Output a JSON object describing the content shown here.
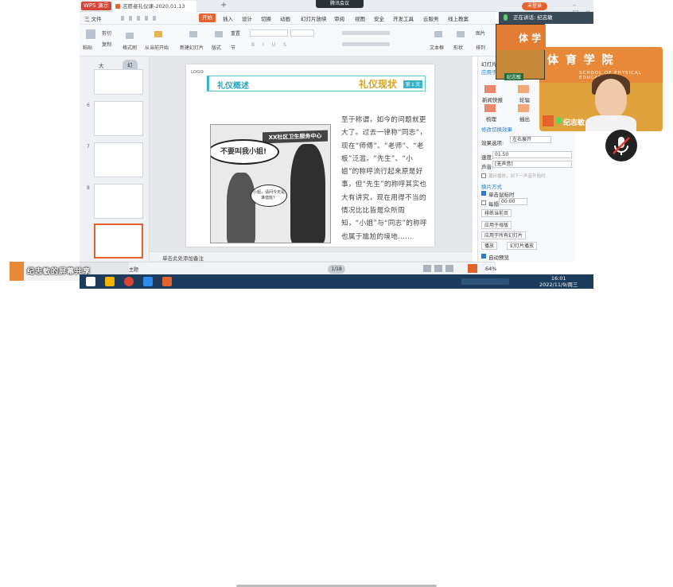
{
  "titlebar": {
    "app": "WPS 演示",
    "doc_title": "志愿者礼仪课-2020.01.13",
    "meeting": "腾讯会议",
    "login": "未登录",
    "new_tab": "+"
  },
  "menu": {
    "file": "三 文件",
    "items": [
      "开始",
      "插入",
      "设计",
      "切换",
      "动画",
      "幻灯片放映",
      "审阅",
      "视图",
      "安全",
      "开发工具",
      "云服务",
      "线上教案"
    ]
  },
  "ribbon": {
    "cut": "剪切",
    "copy": "复制",
    "paste": "粘贴",
    "format_painter": "格式刷",
    "from_current": "从当前开始",
    "new_slide": "新建幻灯片",
    "layout": "版式",
    "section": "节",
    "reset": "重置",
    "text_box": "文本框",
    "shape": "形状",
    "picture": "图片",
    "arrange": "排列"
  },
  "left_pane": {
    "tab_outline": "大纲",
    "tab_slides": "幻灯片",
    "slide_numbers": [
      "6",
      "7",
      "8"
    ]
  },
  "slide": {
    "logo": "LOGO",
    "title_left": "礼仪概述",
    "title_right": "礼仪现状",
    "page_badge": "第 1 页",
    "sign": "XX社区卫生服务中心",
    "bubble1": "不要叫我小姐!",
    "bubble2": "小姐，请问今天是谁值班？",
    "body": "至于称谓，如今的问题就更大了。过去一律称“同志”，现在“师傅”、“老师”、“老板”泛滥。“先生”、“小姐”的称呼流行起来原是好事，但“先生”的称呼其实也大有讲究，现在用得不当的情况比比皆是众所周知，“小姐”与“同志”的称呼也属于尴尬的境地......"
  },
  "notes": "单击此处添加备注",
  "status": {
    "page": "1/18",
    "zoom": "64% -",
    "theme": "主题"
  },
  "right_pane": {
    "section_label": "幻灯片切换",
    "apply_label": "应用于所选幻灯片",
    "effects": [
      "新闻快报",
      "轮辐",
      "梳理",
      "抽出"
    ],
    "modify_header": "修改切换效果",
    "effect_option_label": "效果选项:",
    "effect_option_value": "左右展开",
    "speed_label": "速度:",
    "speed_value": "01.50",
    "sound_label": "声音:",
    "sound_value": "[无声音]",
    "loop_label": "循环播放，到下一声音开始时",
    "advance_header": "换片方式",
    "on_click_label": "单击鼠标时",
    "every_label": "每隔",
    "every_value": "00:00",
    "reorder_btn": "排练当前页",
    "apply_master_btn": "应用于母版",
    "apply_all_btn": "应用于所有幻灯片",
    "play_btn": "播放",
    "slideshow_btn": "幻灯片播放",
    "auto_preview": "自动预览"
  },
  "video": {
    "speaking_label": "正在讲话: 纪志敏",
    "banner": "体 育 学 院",
    "banner_sub": "SCHOOL  OF  PHYSICAL  EDUCATI",
    "name": "纪志敏",
    "small_name": "纪志敏",
    "small_banner": "体 学"
  },
  "share_label": "纪志敏的屏幕共享",
  "taskbar": {
    "time": "16:01",
    "date": "2022/11/9/周三"
  },
  "colors": {
    "accent": "#e4632d",
    "title_blue": "#2aa7bd",
    "title_gold": "#d9a320",
    "taskbar": "#1d3b5c"
  }
}
